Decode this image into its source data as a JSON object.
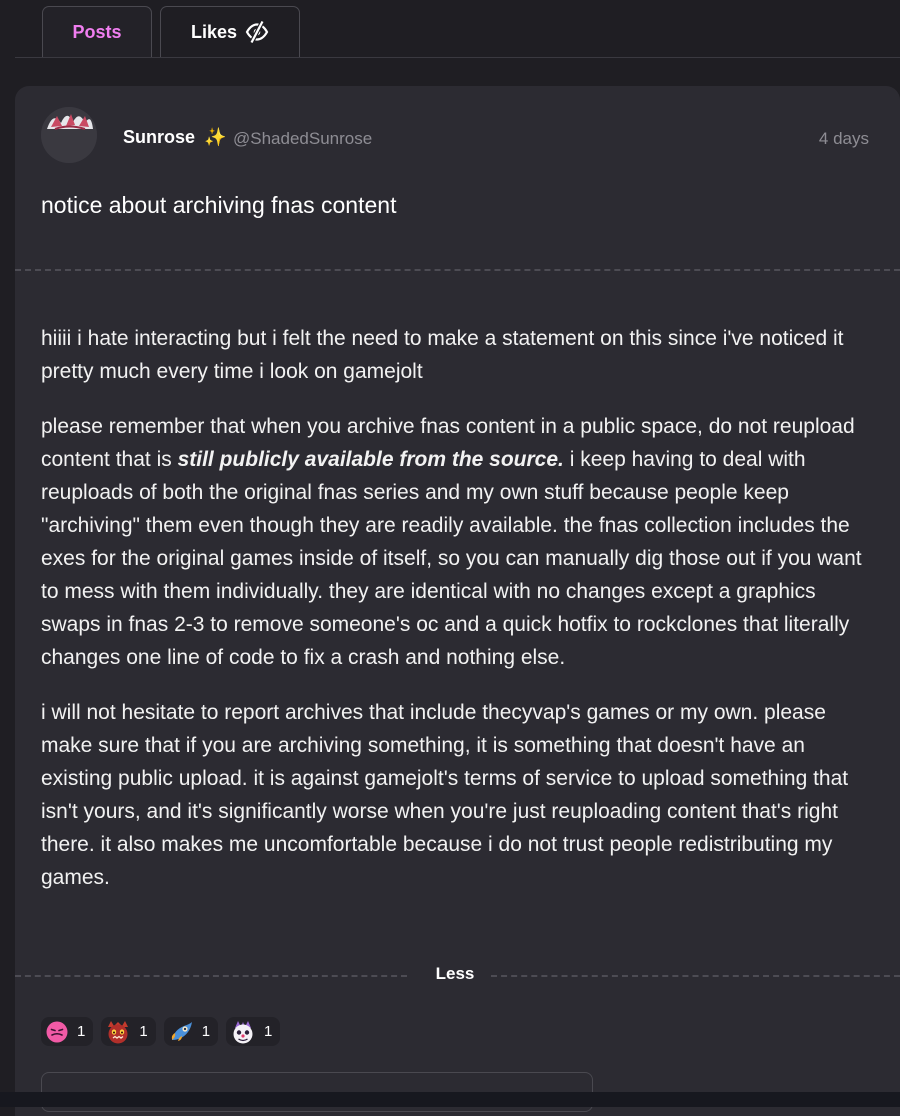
{
  "tabs": {
    "posts": "Posts",
    "likes": "Likes"
  },
  "post": {
    "author_name": "Sunrose",
    "author_badge": "✨",
    "author_handle": "@ShadedSunrose",
    "time": "4 days",
    "title": "notice about archiving fnas content",
    "paragraphs": [
      "hiiii i hate interacting but i felt the need to make a statement on this since i've noticed it pretty much every time i look on gamejolt",
      {
        "before": "please remember that when you archive fnas content in a public space, do not reupload content that is ",
        "emphasis": "still publicly available from the source.",
        "after": " i keep having to deal with reuploads of both the original fnas series and my own stuff because people keep \"archiving\" them even though they are readily available. the fnas collection includes the exes for the original games inside of itself, so you can manually dig those out if you want to mess with them individually. they are identical with no changes except a graphics swaps in fnas 2-3 to remove someone's oc and a quick hotfix to rockclones that literally changes one line of code to fix a crash and nothing else."
      },
      "i will not hesitate to report archives that include thecyvap's games or my own. please make sure that if you are archiving something, it is something that doesn't have an existing public upload. it is against gamejolt's terms of service to upload something that isn't yours, and it's significantly worse when you're just reuploading content that's right there. it also makes me uncomfortable because i do not trust people redistributing my games."
    ],
    "less_label": "Less",
    "reactions": [
      {
        "icon": "pink-face-emoji-icon",
        "count": "1"
      },
      {
        "icon": "red-monster-emoji-icon",
        "count": "1"
      },
      {
        "icon": "rocket-creature-emoji-icon",
        "count": "1"
      },
      {
        "icon": "clown-creature-emoji-icon",
        "count": "1"
      }
    ]
  },
  "colors": {
    "accent": "#f07ef0",
    "background": "#1f1e23",
    "card": "#2c2b32",
    "muted": "#8e8d94",
    "badge": "#f4b43a"
  }
}
